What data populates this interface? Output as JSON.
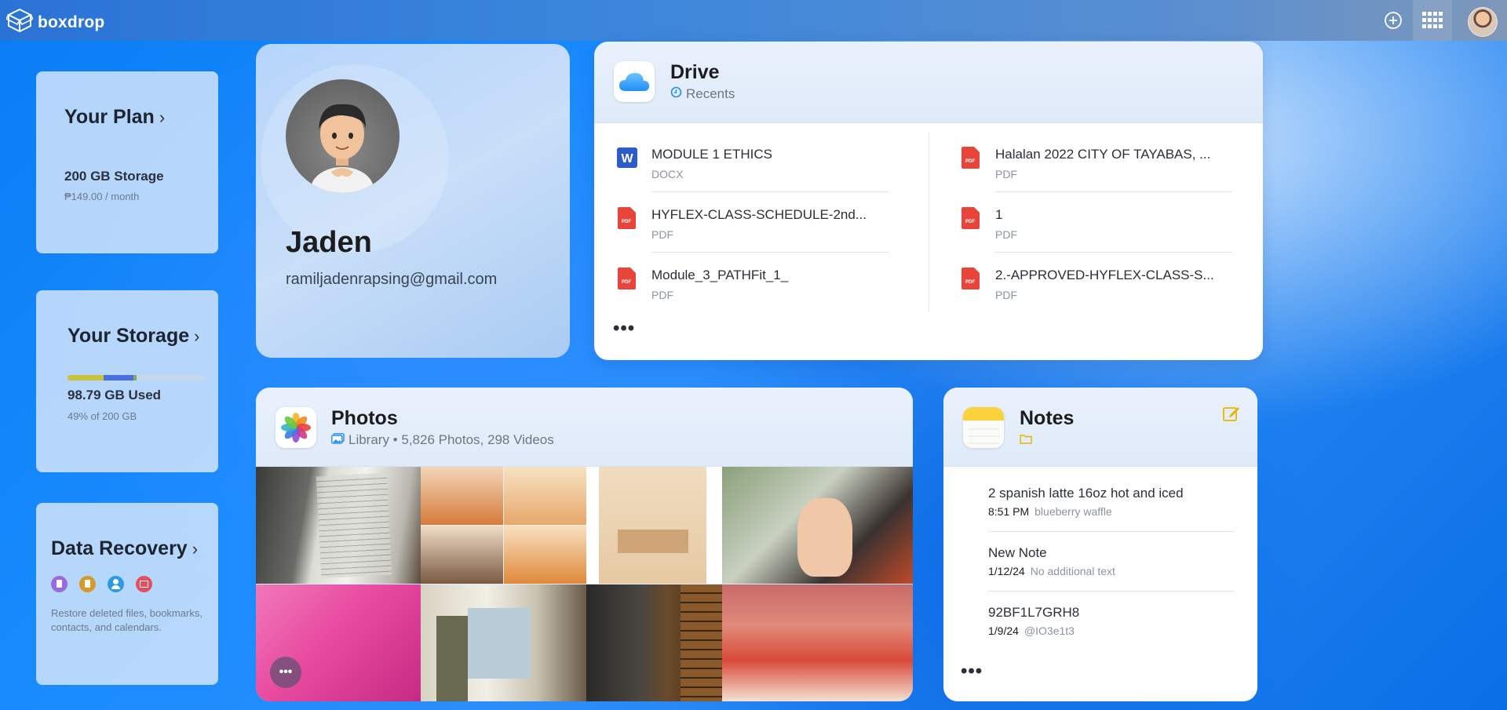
{
  "header": {
    "brand": "boxdrop",
    "icons": [
      "box-logo-icon",
      "add-circle-icon",
      "apps-grid-icon"
    ]
  },
  "plan": {
    "title": "Your Plan",
    "storage": "200 GB Storage",
    "price": "₱149.00 / month"
  },
  "storage": {
    "title": "Your Storage",
    "used": "98.79 GB Used",
    "percent_text": "49% of 200 GB",
    "usage_fraction": 0.49,
    "segments": [
      {
        "color": "#c8c33a",
        "fraction": 0.26
      },
      {
        "color": "#4a6fe0",
        "fraction": 0.22
      },
      {
        "color": "#7fae58",
        "fraction": 0.02
      }
    ]
  },
  "recovery": {
    "title": "Data Recovery",
    "icons": [
      "files-icon",
      "bookmarks-icon",
      "contacts-icon",
      "calendar-icon"
    ],
    "description": "Restore deleted files, bookmarks, contacts, and calendars."
  },
  "profile": {
    "name": "Jaden",
    "email": "ramiljadenrapsing@gmail.com"
  },
  "drive": {
    "title": "Drive",
    "subtitle": "Recents",
    "more": "•••",
    "files": [
      {
        "name": "MODULE 1 ETHICS",
        "type": "DOCX",
        "icon": "word-doc-icon"
      },
      {
        "name": "HYFLEX-CLASS-SCHEDULE-2nd...",
        "type": "PDF",
        "icon": "pdf-icon"
      },
      {
        "name": "Module_3_PATHFit_1_",
        "type": "PDF",
        "icon": "pdf-icon"
      },
      {
        "name": "Halalan 2022 CITY OF TAYABAS, ...",
        "type": "PDF",
        "icon": "pdf-icon"
      },
      {
        "name": "1",
        "type": "PDF",
        "icon": "pdf-icon"
      },
      {
        "name": "2.-APPROVED-HYFLEX-CLASS-S...",
        "type": "PDF",
        "icon": "pdf-icon"
      }
    ]
  },
  "photos": {
    "title": "Photos",
    "subtitle": "Library • 5,826 Photos, 298 Videos",
    "more": "•••"
  },
  "notes": {
    "title": "Notes",
    "more": "•••",
    "items": [
      {
        "title": "2 spanish latte 16oz hot and iced",
        "time": "8:51 PM",
        "preview": "blueberry waffle"
      },
      {
        "title": "New Note",
        "time": "1/12/24",
        "preview": "No additional text"
      },
      {
        "title": "92BF1L7GRH8",
        "time": "1/9/24",
        "preview": "@IO3e1t3"
      }
    ]
  }
}
